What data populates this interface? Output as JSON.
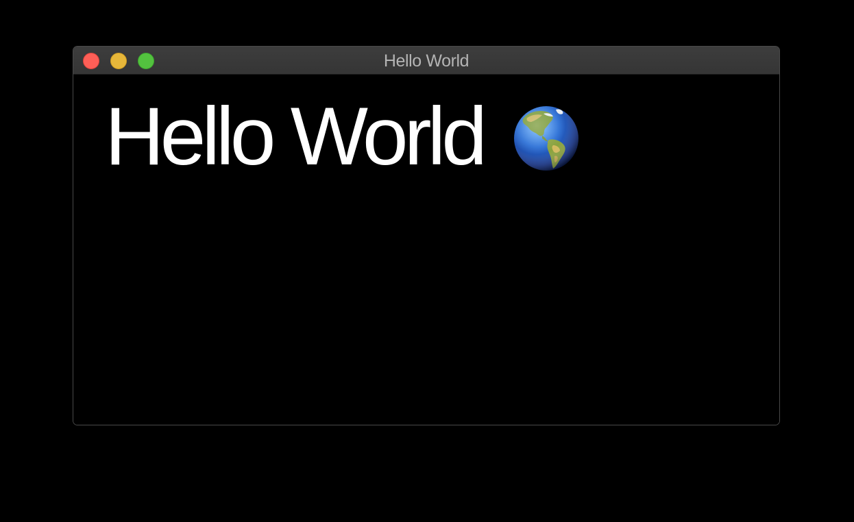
{
  "window": {
    "title": "Hello World",
    "controls": {
      "close_color": "#fe5f57",
      "minimize_color": "#e7b73a",
      "zoom_color": "#53c23f"
    }
  },
  "content": {
    "heading": "Hello World",
    "heading_icon": "globe-americas-icon",
    "text_color": "#ffffff",
    "background_color": "#000000"
  }
}
